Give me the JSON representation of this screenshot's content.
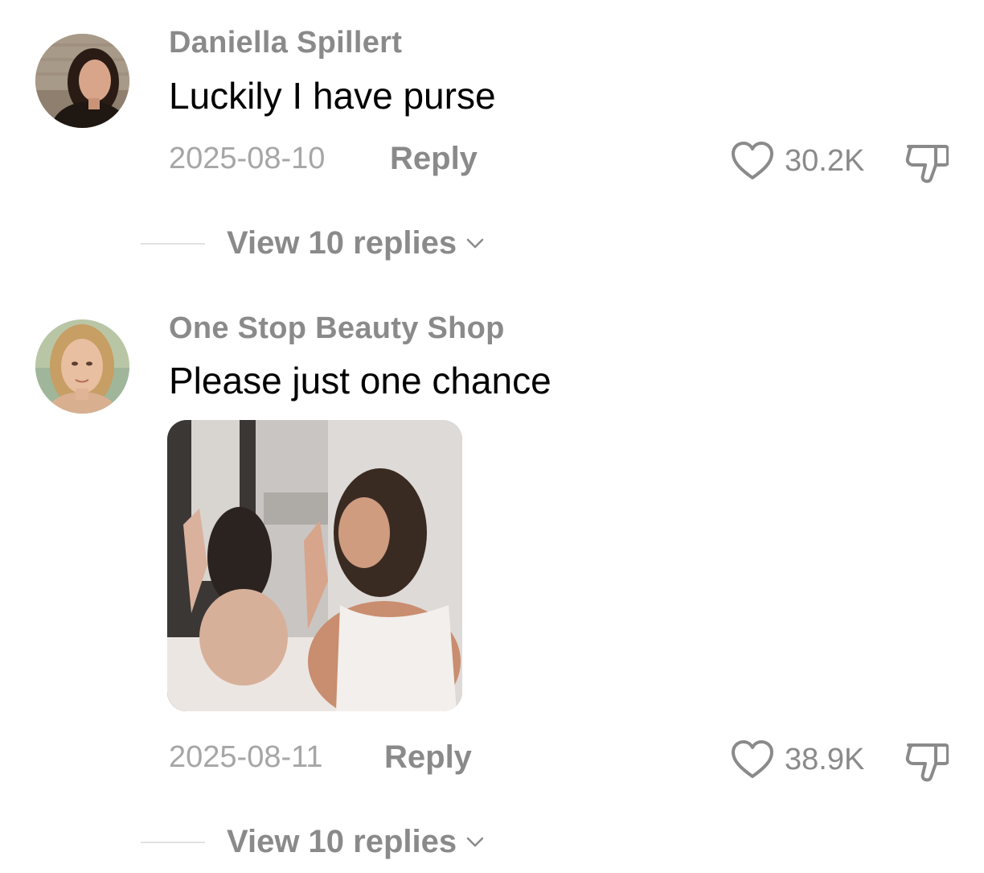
{
  "comments": [
    {
      "username": "Daniella Spillert",
      "text": "Luckily I have purse",
      "date": "2025-08-10",
      "reply_label": "Reply",
      "likes": "30.2K",
      "view_replies": "View 10 replies",
      "avatar_icon": "profile-photo-woman-dark-hair"
    },
    {
      "username": "One Stop Beauty Shop",
      "text": "Please just one chance",
      "date": "2025-08-11",
      "reply_label": "Reply",
      "likes": "38.9K",
      "view_replies": "View 10 replies",
      "avatar_icon": "profile-photo-woman-blonde-hair",
      "attachment_icon": "photo-two-women-praying"
    }
  ],
  "icons": {
    "like": "heart-outline-icon",
    "dislike": "thumbs-down-outline-icon",
    "expand": "chevron-down-icon"
  },
  "colors": {
    "username": "#8a8a8a",
    "text": "#000000",
    "meta": "#a6a6a6",
    "divider": "#e2e2e2"
  }
}
